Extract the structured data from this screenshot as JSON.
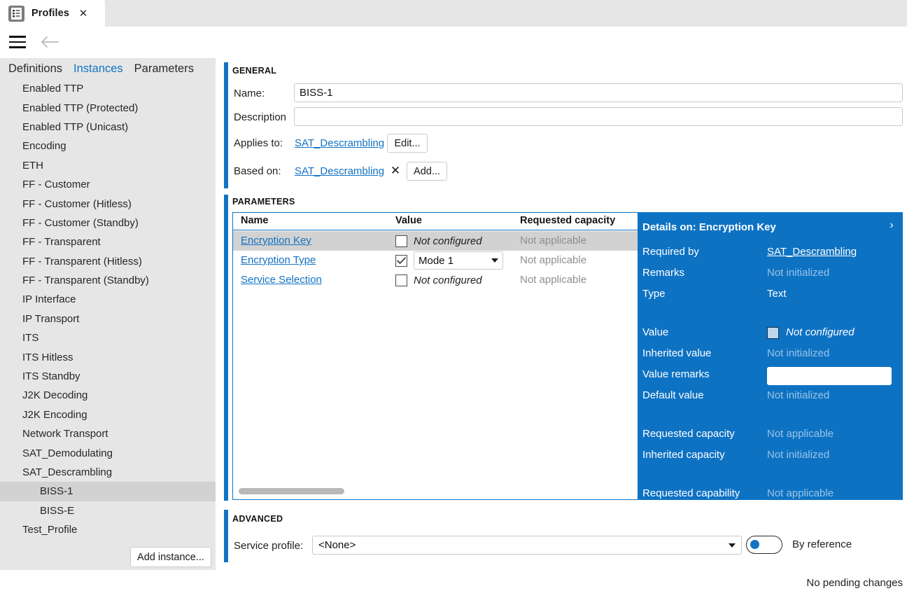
{
  "window": {
    "tab_title": "Profiles",
    "tab_icon": "document-list-icon",
    "close_icon": "✕",
    "menu_icon": "hamburger-icon",
    "back_icon": "back-arrow-icon"
  },
  "sidebar": {
    "nav_tabs": [
      {
        "label": "Definitions",
        "active": false
      },
      {
        "label": "Instances",
        "active": true
      },
      {
        "label": "Parameters",
        "active": false
      }
    ],
    "items": [
      {
        "label": "Enabled TTP",
        "level": 1,
        "selected": false
      },
      {
        "label": "Enabled TTP (Protected)",
        "level": 1,
        "selected": false
      },
      {
        "label": "Enabled TTP (Unicast)",
        "level": 1,
        "selected": false
      },
      {
        "label": "Encoding",
        "level": 1,
        "selected": false
      },
      {
        "label": "ETH",
        "level": 1,
        "selected": false
      },
      {
        "label": "FF - Customer",
        "level": 1,
        "selected": false
      },
      {
        "label": "FF - Customer (Hitless)",
        "level": 1,
        "selected": false
      },
      {
        "label": "FF - Customer (Standby)",
        "level": 1,
        "selected": false
      },
      {
        "label": "FF - Transparent",
        "level": 1,
        "selected": false
      },
      {
        "label": "FF - Transparent (Hitless)",
        "level": 1,
        "selected": false
      },
      {
        "label": "FF - Transparent (Standby)",
        "level": 1,
        "selected": false
      },
      {
        "label": "IP Interface",
        "level": 1,
        "selected": false
      },
      {
        "label": "IP Transport",
        "level": 1,
        "selected": false
      },
      {
        "label": "ITS",
        "level": 1,
        "selected": false
      },
      {
        "label": "ITS Hitless",
        "level": 1,
        "selected": false
      },
      {
        "label": "ITS Standby",
        "level": 1,
        "selected": false
      },
      {
        "label": "J2K Decoding",
        "level": 1,
        "selected": false
      },
      {
        "label": "J2K Encoding",
        "level": 1,
        "selected": false
      },
      {
        "label": "Network Transport",
        "level": 1,
        "selected": false
      },
      {
        "label": "SAT_Demodulating",
        "level": 1,
        "selected": false
      },
      {
        "label": "SAT_Descrambling",
        "level": 1,
        "selected": false
      },
      {
        "label": "BISS-1",
        "level": 2,
        "selected": true
      },
      {
        "label": "BISS-E",
        "level": 2,
        "selected": false
      },
      {
        "label": "Test_Profile",
        "level": 1,
        "selected": false
      }
    ],
    "add_instance_label": "Add instance..."
  },
  "general": {
    "heading": "GENERAL",
    "name_label": "Name:",
    "name_value": "BISS-1",
    "description_label": "Description",
    "description_value": "",
    "applies_to_label": "Applies to:",
    "applies_to_link": "SAT_Descrambling",
    "edit_button": "Edit...",
    "based_on_label": "Based on:",
    "based_on_link": "SAT_Descrambling",
    "remove_icon": "✕",
    "add_button": "Add..."
  },
  "parameters": {
    "heading": "PARAMETERS",
    "columns": [
      "Name",
      "Value",
      "Requested capacity"
    ],
    "rows": [
      {
        "name": "Encryption Key",
        "checked": false,
        "value_text": "Not configured",
        "value_kind": "text",
        "capacity": "Not applicable",
        "selected": true
      },
      {
        "name": "Encryption Type",
        "checked": true,
        "value_text": "Mode 1",
        "value_kind": "dropdown",
        "capacity": "Not applicable",
        "selected": false
      },
      {
        "name": "Service Selection",
        "checked": false,
        "value_text": "Not configured",
        "value_kind": "text",
        "capacity": "Not applicable",
        "selected": false
      }
    ]
  },
  "details": {
    "title": "Details on: Encryption Key",
    "collapse_icon": "›",
    "rows": [
      {
        "key": "Required by",
        "value": "SAT_Descrambling",
        "kind": "link"
      },
      {
        "key": "Remarks",
        "value": "Not initialized",
        "kind": "dim"
      },
      {
        "key": "Type",
        "value": "Text",
        "kind": "plain"
      },
      {
        "key": "Value",
        "value": "Not configured",
        "kind": "checkbox"
      },
      {
        "key": "Inherited value",
        "value": "Not initialized",
        "kind": "dim"
      },
      {
        "key": "Value remarks",
        "value": "",
        "kind": "input"
      },
      {
        "key": "Default value",
        "value": "Not initialized",
        "kind": "dim"
      },
      {
        "key": "Requested capacity",
        "value": "Not applicable",
        "kind": "dim"
      },
      {
        "key": "Inherited capacity",
        "value": "Not initialized",
        "kind": "dim"
      },
      {
        "key": "Requested capability",
        "value": "Not applicable",
        "kind": "dim"
      }
    ]
  },
  "advanced": {
    "heading": "ADVANCED",
    "service_profile_label": "Service profile:",
    "service_profile_value": "<None>",
    "toggle_state": "off",
    "toggle_label": "By reference"
  },
  "statusbar": {
    "text": "No pending changes"
  },
  "colors": {
    "accent": "#1273c4",
    "details_bg": "#0e72c3",
    "sidebar_bg": "#e6e6e6",
    "selection": "#d2d2d2"
  }
}
